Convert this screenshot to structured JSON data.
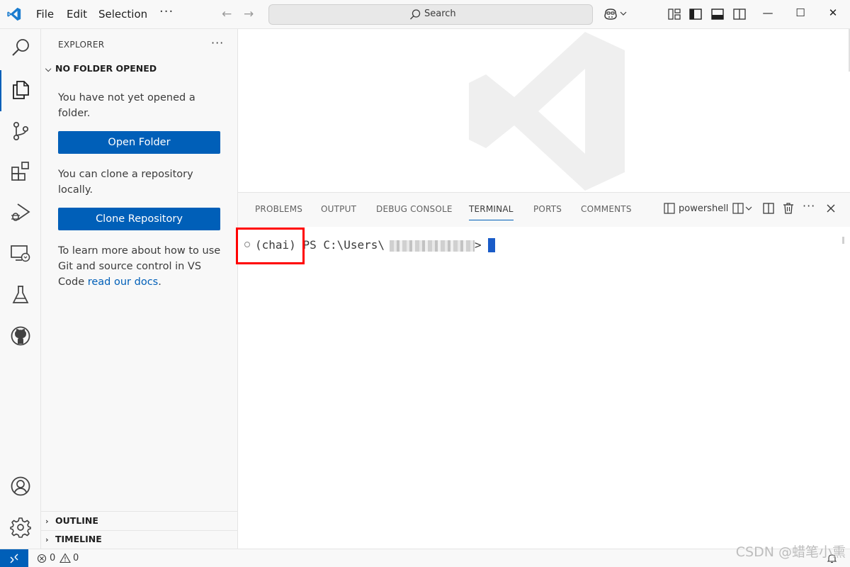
{
  "titlebar": {
    "menus": [
      "File",
      "Edit",
      "Selection"
    ],
    "more": "···",
    "back_arrow": "←",
    "forward_arrow": "→",
    "search_placeholder": "Search",
    "window_controls": [
      "—",
      "☐",
      "✕"
    ]
  },
  "sidebar": {
    "title": "EXPLORER",
    "more": "···",
    "section_no_folder": "NO FOLDER OPENED",
    "text_no_folder": "You have not yet opened a folder.",
    "open_folder_button": "Open Folder",
    "text_clone": "You can clone a repository locally.",
    "clone_button": "Clone Repository",
    "text_learn_prefix": "To learn more about how to use Git and source control in VS Code ",
    "text_learn_link": "read our docs",
    "text_learn_suffix": ".",
    "section_outline": "OUTLINE",
    "section_timeline": "TIMELINE"
  },
  "panel": {
    "tabs": [
      "PROBLEMS",
      "OUTPUT",
      "DEBUG CONSOLE",
      "TERMINAL",
      "PORTS",
      "COMMENTS"
    ],
    "active_tab": "TERMINAL",
    "shell": "powershell",
    "terminal": {
      "env": "(chai)",
      "prompt": "PS C:\\Users\\",
      "prompt_end": ">"
    }
  },
  "statusbar": {
    "errors": "0",
    "warnings": "0"
  },
  "watermark": "CSDN @蜡笔小熏",
  "colors": {
    "accent": "#005fb8",
    "highlight": "#ff0000"
  }
}
